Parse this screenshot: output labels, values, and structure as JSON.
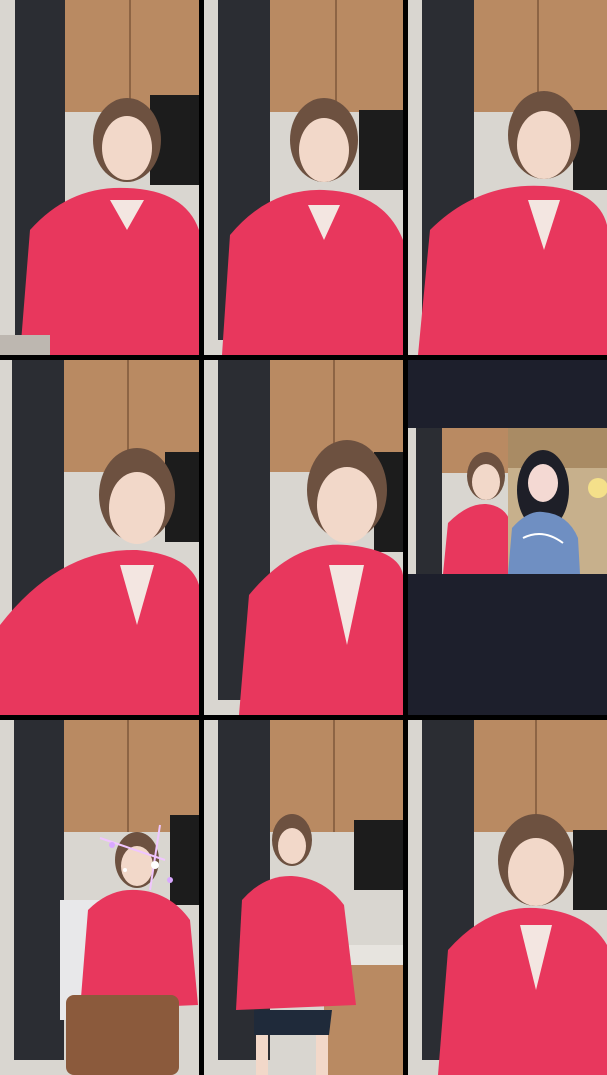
{
  "colors": {
    "background": "#000000",
    "empty_tile": "#1d1f2c",
    "hoodie": "#e8375d",
    "cabinet": "#b98a62",
    "tile_wall": "#2b2d33"
  },
  "tiles": [
    {
      "id": "r1c1",
      "kind": "video"
    },
    {
      "id": "r1c2",
      "kind": "video"
    },
    {
      "id": "r1c3",
      "kind": "video"
    },
    {
      "id": "r2c1",
      "kind": "video"
    },
    {
      "id": "r2c2",
      "kind": "video"
    },
    {
      "id": "r2c3",
      "kind": "guest-split"
    },
    {
      "id": "r3c1",
      "kind": "video-with-effect"
    },
    {
      "id": "r3c2",
      "kind": "video-fullbody"
    },
    {
      "id": "r3c3",
      "kind": "video"
    }
  ]
}
